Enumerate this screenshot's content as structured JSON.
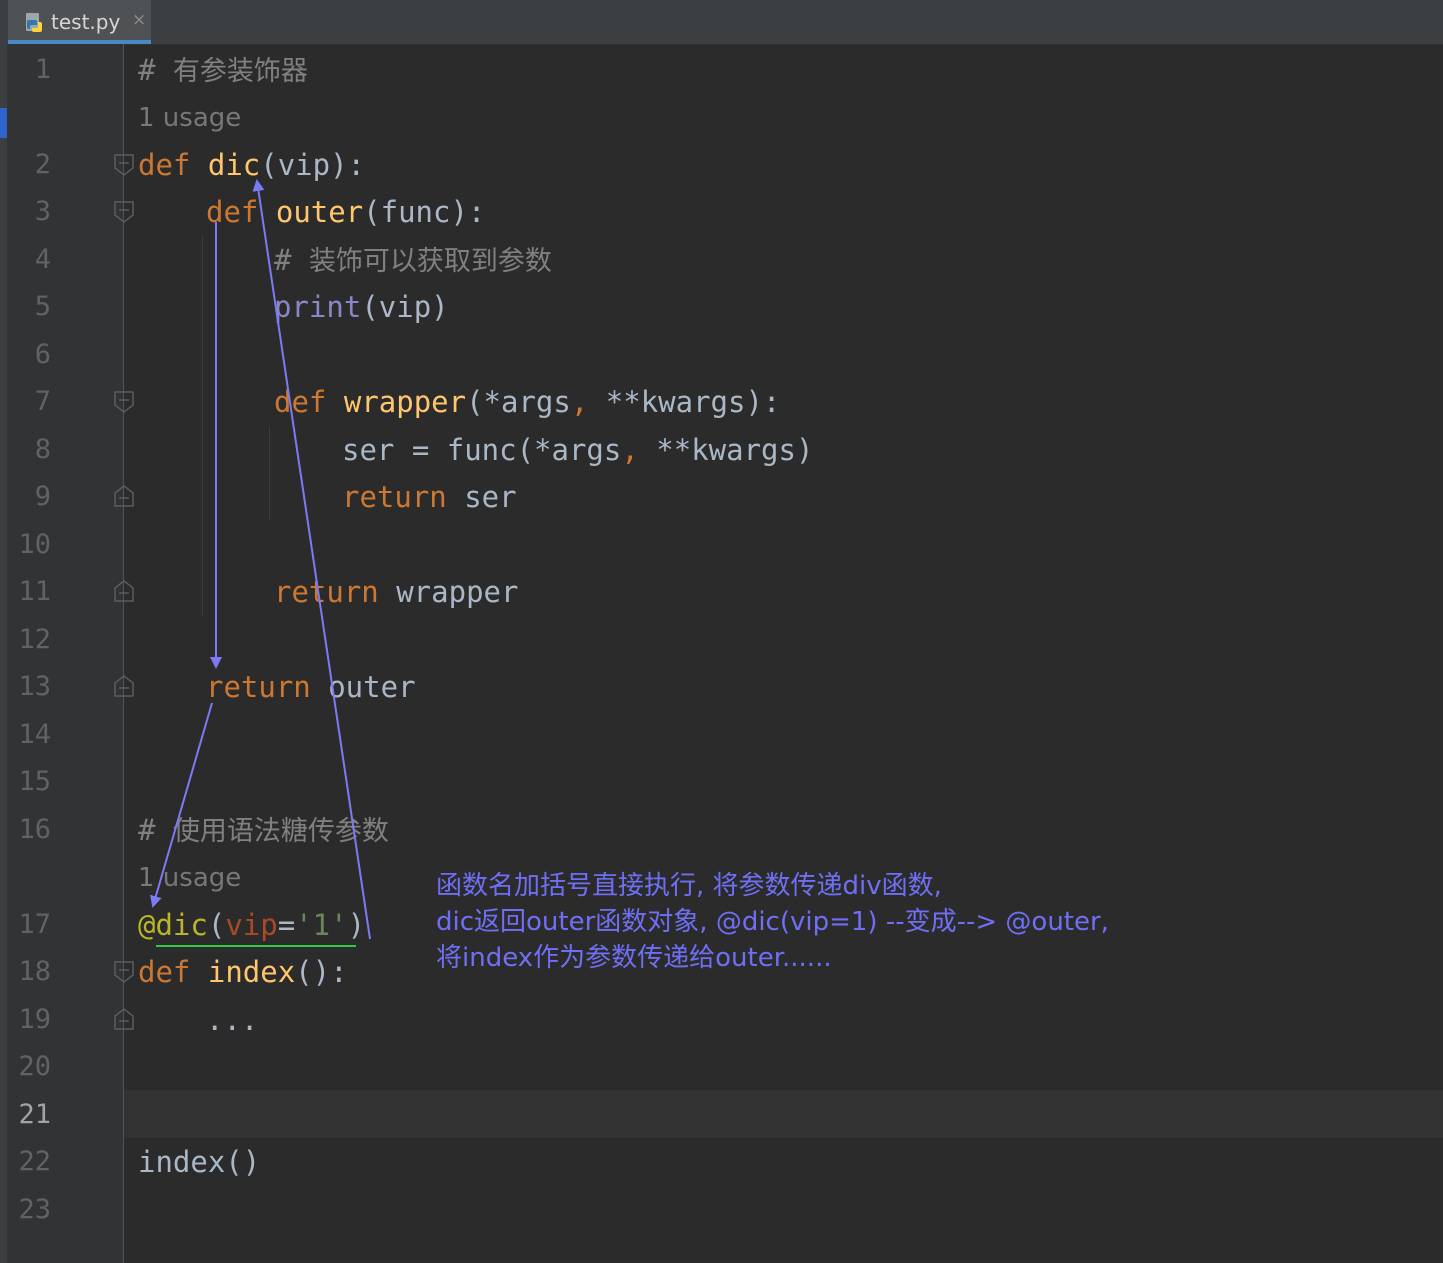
{
  "tab": {
    "filename": "test.py",
    "close": "×"
  },
  "line_numbers": [
    "1",
    "2",
    "3",
    "4",
    "5",
    "6",
    "7",
    "8",
    "9",
    "10",
    "11",
    "12",
    "13",
    "14",
    "15",
    "16",
    "17",
    "18",
    "19",
    "20",
    "21",
    "22",
    "23"
  ],
  "current_line": "21",
  "inlay": {
    "usage_1": "1 usage",
    "usage_2": "1 usage"
  },
  "code": {
    "l1": {
      "hash": "#",
      "comment": "有参装饰器"
    },
    "l2": {
      "kw": "def",
      "name": "dic",
      "rest": "(vip):"
    },
    "l3": {
      "kw": "def",
      "name": "outer",
      "rest": "(func):"
    },
    "l4": {
      "hash": "#",
      "comment": "装饰可以获取到参数"
    },
    "l5": {
      "builtin": "print",
      "rest": "(vip)"
    },
    "l7": {
      "kw": "def",
      "name": "wrapper",
      "p1": "(*args",
      "comma": ",",
      "p2": " **kwargs):"
    },
    "l8": {
      "a": "ser = func(*args",
      "comma": ",",
      "b": " **kwargs)"
    },
    "l9": {
      "kw": "return",
      "rest": " ser"
    },
    "l11": {
      "kw": "return",
      "rest": " wrapper"
    },
    "l13": {
      "kw": "return",
      "rest": " outer"
    },
    "l16": {
      "hash": "#",
      "comment": "使用语法糖传参数"
    },
    "l17": {
      "dec": "@dic",
      "open": "(",
      "param": "vip",
      "eq": "=",
      "str": "'1'",
      "close": ")"
    },
    "l18": {
      "kw": "def",
      "name": "index",
      "rest": "():"
    },
    "l19": {
      "ellipsis": "..."
    },
    "l22": {
      "call": "index()"
    }
  },
  "annotation": {
    "line1": "函数名加括号直接执行, 将参数传递div函数,",
    "line2": "dic返回outer函数对象, @dic(vip=1) --变成--> @outer,",
    "line3": "将index作为参数传递给outer......"
  },
  "colors": {
    "editor_bg": "#2b2b2b",
    "keyword": "#cc7832",
    "function": "#ffc66d",
    "builtin": "#8888c6",
    "comment": "#808080",
    "string": "#6a8759",
    "decorator": "#bbb529",
    "annotation": "#6f6ff5",
    "underline": "#2ecc40"
  }
}
